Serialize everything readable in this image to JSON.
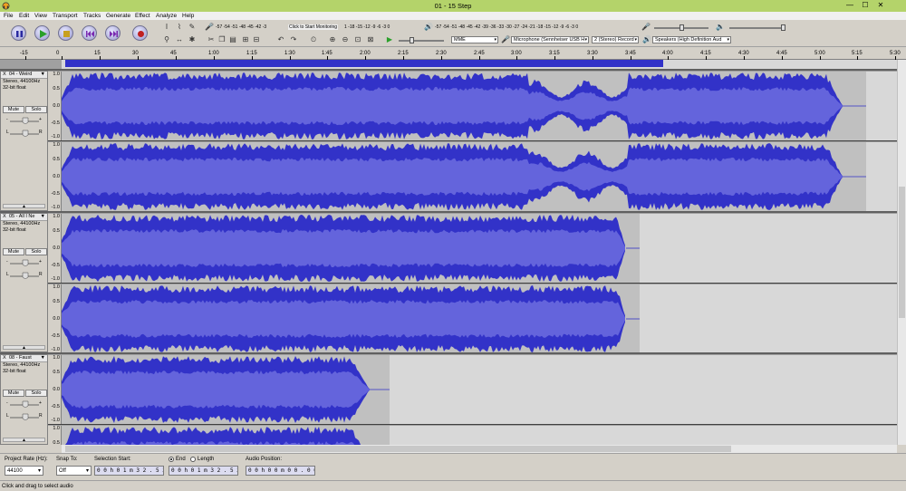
{
  "window": {
    "title": "01 - 15 Step",
    "min_glyph": "—",
    "max_glyph": "☐",
    "close_glyph": "✕"
  },
  "menu": [
    "File",
    "Edit",
    "View",
    "Transport",
    "Tracks",
    "Generate",
    "Effect",
    "Analyze",
    "Help"
  ],
  "toolbar": {
    "record_meter_scale": "-57 -54 -51 -48 -45 -42 -3",
    "monitor_prompt": "Click to Start Monitoring",
    "record_meter_scale_tail": "1 -18 -15 -12 -9 -6 -3 0",
    "play_meter_scale": "-57 -54 -51 -48 -45 -42 -39 -36 -33 -30 -27 -24 -21 -18 -15 -12 -9 -6 -3 0",
    "lr_label": "L R",
    "host": "MME",
    "recording_device": "Microphone (Sennheiser USB H",
    "channels": "2 (Stereo) Record",
    "playback_device": "Speakers (High Definition Aud"
  },
  "ruler": {
    "ticks": [
      "-15",
      "0",
      "15",
      "30",
      "45",
      "1:00",
      "1:15",
      "1:30",
      "1:45",
      "2:00",
      "2:15",
      "2:30",
      "2:45",
      "3:00",
      "3:15",
      "3:30",
      "3:45",
      "4:00",
      "4:15",
      "4:30",
      "4:45",
      "5:00",
      "5:15",
      "5:30"
    ]
  },
  "tracks": [
    {
      "name": "04 - Weird",
      "format": "Stereo, 44100Hz",
      "bits": "32-bit float",
      "mute": "Mute",
      "solo": "Solo",
      "close": "X",
      "menu": "▼",
      "collapse": "▲"
    },
    {
      "name": "05 - All I Ne",
      "format": "Stereo, 44100Hz",
      "bits": "32-bit float",
      "mute": "Mute",
      "solo": "Solo",
      "close": "X",
      "menu": "▼",
      "collapse": "▲"
    },
    {
      "name": "08 - Faust",
      "format": "Stereo, 44100Hz",
      "bits": "32-bit float",
      "mute": "Mute",
      "solo": "Solo",
      "close": "X",
      "menu": "▼",
      "collapse": "▲"
    }
  ],
  "amplitude": {
    "top": "1.0",
    "half": "0.5",
    "zero": "0.0",
    "neg_half": "-0.5",
    "bottom": "-1.0"
  },
  "selection": {
    "project_rate_label": "Project Rate (Hz):",
    "project_rate": "44100",
    "snap_label": "Snap To:",
    "snap": "Off",
    "sel_start_label": "Selection Start:",
    "sel_start": "0 0 h 0 1 m 3 2 . 5 3 4 s",
    "end_label": "End",
    "length_label": "Length",
    "sel_end": "0 0 h 0 1 m 3 2 . 5 3 4 s",
    "audio_pos_label": "Audio Position:",
    "audio_pos": "0 0 h 0 0 m 0 0 . 0 0 0 s"
  },
  "status": "Click and drag to select audio",
  "colors": {
    "wave": "#3232c8",
    "wave_rms": "#6464dc",
    "titlebar": "#b4d36a"
  }
}
